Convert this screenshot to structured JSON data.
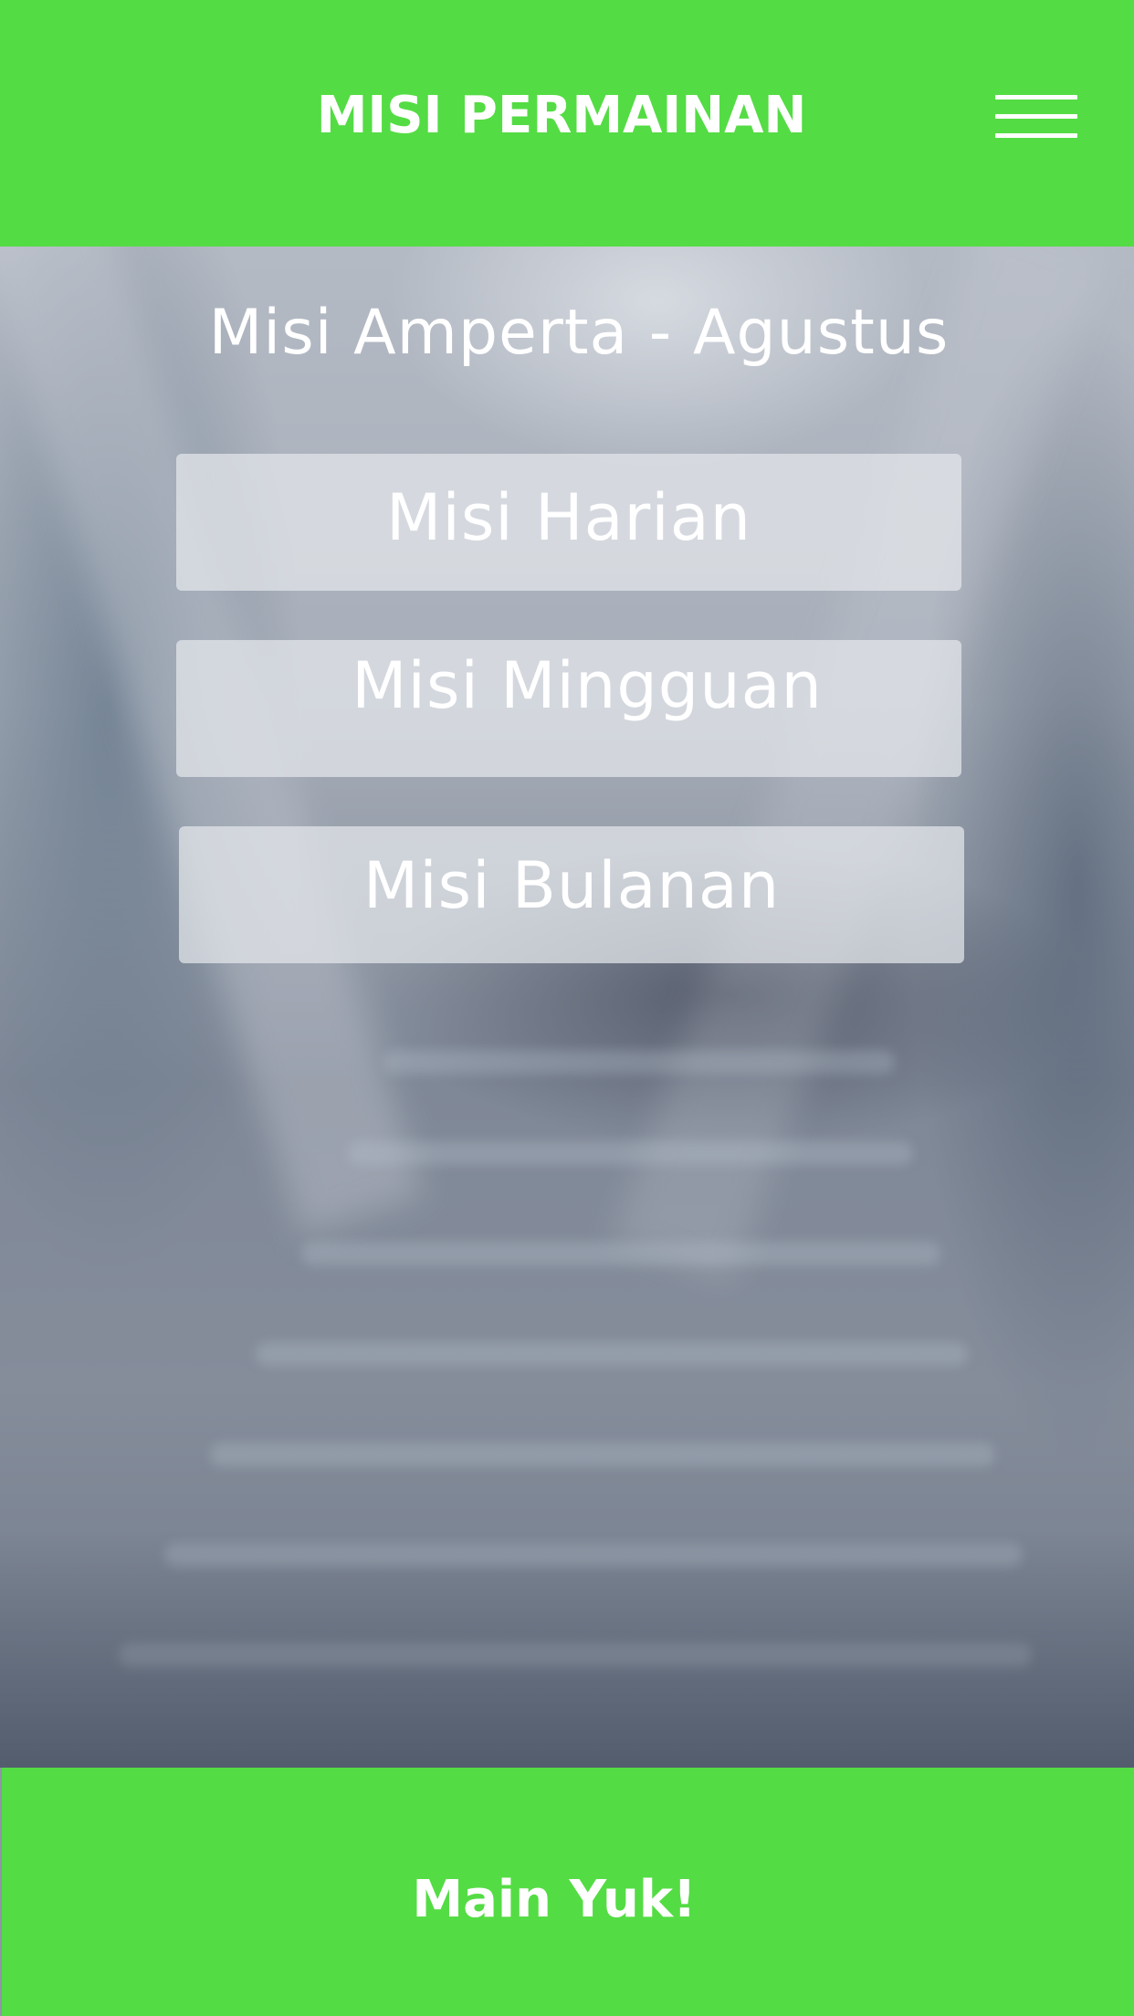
{
  "header": {
    "title": "MISI PERMAINAN",
    "menu_icon": "hamburger-menu-icon",
    "color": "#54dc44"
  },
  "main": {
    "subtitle": "Misi Amperta - Agustus",
    "buttons": [
      {
        "label": "Misi Harian"
      },
      {
        "label": "Misi Mingguan"
      },
      {
        "label": "Misi Bulanan"
      }
    ]
  },
  "footer": {
    "cta_label": "Main Yuk!",
    "color": "#54dc44"
  }
}
